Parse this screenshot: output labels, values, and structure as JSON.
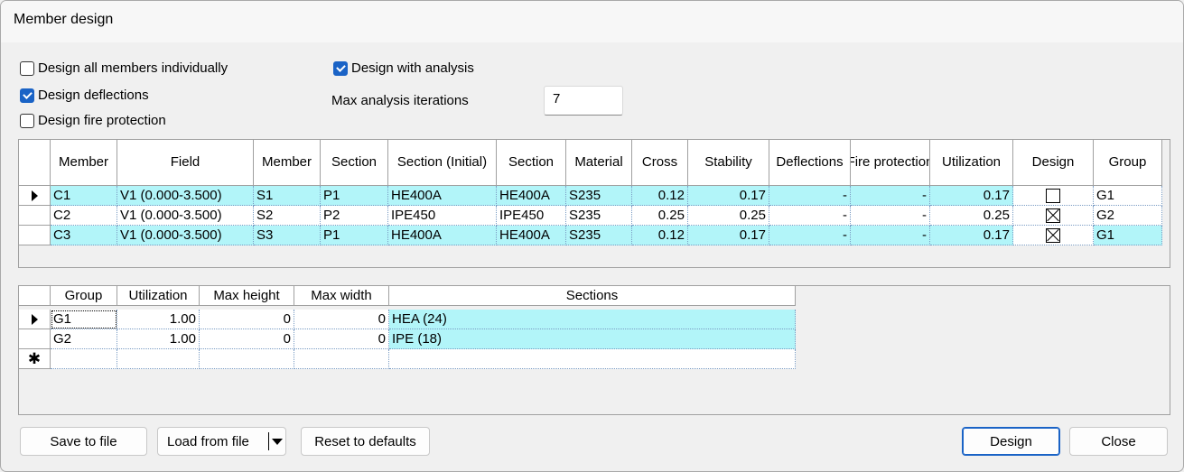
{
  "window": {
    "title": "Member design"
  },
  "options": {
    "design_individually": {
      "label": "Design all members individually",
      "checked": false
    },
    "design_deflections": {
      "label": "Design deflections",
      "checked": true
    },
    "design_fire": {
      "label": "Design fire protection",
      "checked": false
    },
    "design_with_analysis": {
      "label": "Design with analysis",
      "checked": true
    },
    "max_iterations_label": "Max analysis iterations",
    "max_iterations_value": "7"
  },
  "members_table": {
    "headers": {
      "member": "Member",
      "field": "Field",
      "member2": "Member",
      "section": "Section",
      "section_initial": "Section (Initial)",
      "section2": "Section",
      "material": "Material",
      "cross": "Cross",
      "stability": "Stability",
      "deflections": "Deflections",
      "fire": "Fire protection",
      "utilization": "Utilization",
      "design": "Design",
      "group": "Group"
    },
    "rows": [
      {
        "member": "C1",
        "field": "V1 (0.000-3.500)",
        "member2": "S1",
        "section": "P1",
        "section_initial": "HE400A",
        "section2": "HE400A",
        "material": "S235",
        "cross": "0.12",
        "stability": "0.17",
        "deflections": "-",
        "fire": "-",
        "utilization": "0.17",
        "design": false,
        "group": "G1"
      },
      {
        "member": "C2",
        "field": "V1 (0.000-3.500)",
        "member2": "S2",
        "section": "P2",
        "section_initial": "IPE450",
        "section2": "IPE450",
        "material": "S235",
        "cross": "0.25",
        "stability": "0.25",
        "deflections": "-",
        "fire": "-",
        "utilization": "0.25",
        "design": true,
        "group": "G2"
      },
      {
        "member": "C3",
        "field": "V1 (0.000-3.500)",
        "member2": "S3",
        "section": "P1",
        "section_initial": "HE400A",
        "section2": "HE400A",
        "material": "S235",
        "cross": "0.12",
        "stability": "0.17",
        "deflections": "-",
        "fire": "-",
        "utilization": "0.17",
        "design": true,
        "group": "G1"
      }
    ]
  },
  "groups_table": {
    "headers": {
      "group": "Group",
      "utilization": "Utilization",
      "max_height": "Max height",
      "max_width": "Max width",
      "sections": "Sections"
    },
    "rows": [
      {
        "group": "G1",
        "utilization": "1.00",
        "max_height": "0",
        "max_width": "0",
        "sections": "HEA (24)"
      },
      {
        "group": "G2",
        "utilization": "1.00",
        "max_height": "0",
        "max_width": "0",
        "sections": "IPE (18)"
      }
    ],
    "new_row_marker": "✱"
  },
  "buttons": {
    "save": "Save to file",
    "load": "Load from file",
    "reset": "Reset to defaults",
    "design": "Design",
    "close": "Close"
  },
  "colors": {
    "accent": "#1a63c6",
    "row_highlight": "#b2f5f9"
  }
}
